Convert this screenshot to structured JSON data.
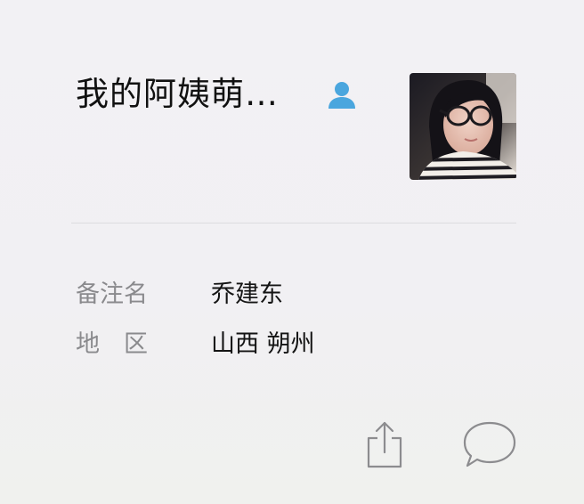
{
  "profile": {
    "name": "我的阿姨萌…",
    "contact_icon": "person-icon",
    "avatar": "profile-photo"
  },
  "details": {
    "remark_label": "备注名",
    "remark_value": "乔建东",
    "region_label": "地　区",
    "region_value": "山西 朔州"
  },
  "actions": {
    "share_icon": "share-icon",
    "message_icon": "message-bubble-icon"
  },
  "colors": {
    "accent": "#4aa6de",
    "label": "#8a8a8d",
    "value": "#141414",
    "icon_stroke": "#8c8c8f"
  }
}
